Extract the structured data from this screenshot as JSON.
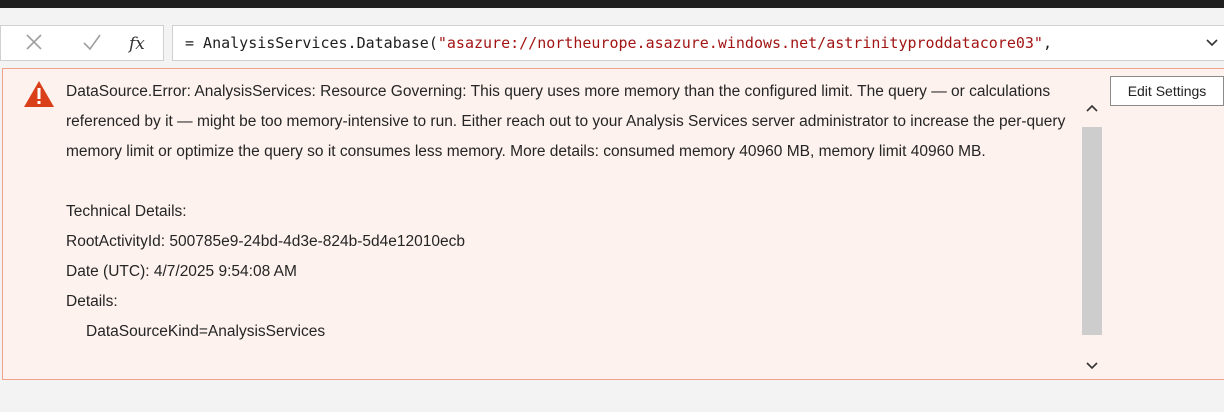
{
  "formula_bar": {
    "cancel_icon": "close-icon",
    "commit_icon": "checkmark-icon",
    "fx_label": "fx",
    "formula_prefix": "= AnalysisServices.Database(",
    "formula_string": "\"asazure://northeurope.asazure.windows.net/astrinityproddatacore03\"",
    "formula_suffix": ",",
    "expand_icon": "chevron-down-icon"
  },
  "error": {
    "icon": "warning-icon",
    "message": "DataSource.Error: AnalysisServices: Resource Governing: This query uses more memory than the configured limit. The query — or calculations referenced by it — might be too memory-intensive to run. Either reach out to your Analysis Services server administrator to increase the per-query memory limit or optimize the query so it consumes less memory. More details: consumed memory 40960 MB, memory limit 40960 MB.",
    "technical_details_label": "Technical Details:",
    "root_activity": "RootActivityId: 500785e9-24bd-4d3e-824b-5d4e12010ecb",
    "date": "Date (UTC): 4/7/2025 9:54:08 AM",
    "details_label": "Details:",
    "data_source_kind": "DataSourceKind=AnalysisServices",
    "edit_settings_label": "Edit Settings"
  },
  "colors": {
    "error_background": "#fdf2ee",
    "error_border": "#f1a08c",
    "warning_icon": "#d9401a",
    "formula_string": "#a31515"
  }
}
